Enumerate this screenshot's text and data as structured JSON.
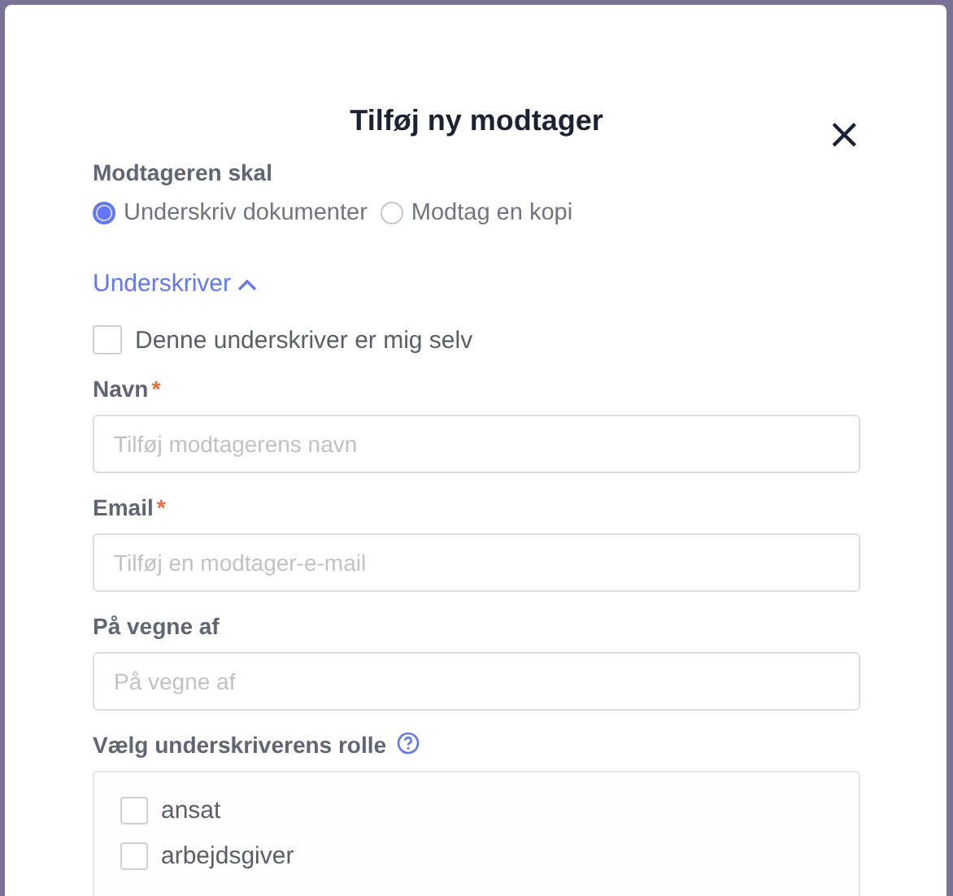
{
  "dialog": {
    "title": "Tilføj ny modtager",
    "close": "×"
  },
  "recipient_action": {
    "label": "Modtageren skal",
    "options": [
      {
        "label": "Underskriv dokumenter",
        "selected": true
      },
      {
        "label": "Modtag en kopi",
        "selected": false
      }
    ]
  },
  "section": {
    "label": "Underskriver",
    "expanded": true
  },
  "self_checkbox": {
    "label": "Denne underskriver er mig selv",
    "checked": false
  },
  "required_mark": "*",
  "fields": [
    {
      "label": "Navn",
      "required": true,
      "placeholder": "Tilføj modtagerens navn"
    },
    {
      "label": "Email",
      "required": true,
      "placeholder": "Tilføj en modtager-e-mail"
    },
    {
      "label": "På vegne af",
      "required": false,
      "placeholder": "På vegne af"
    }
  ],
  "roles": {
    "label": "Vælg underskriverens rolle",
    "options": [
      {
        "label": "ansat",
        "checked": false
      },
      {
        "label": "arbejdsgiver",
        "checked": false
      }
    ]
  }
}
